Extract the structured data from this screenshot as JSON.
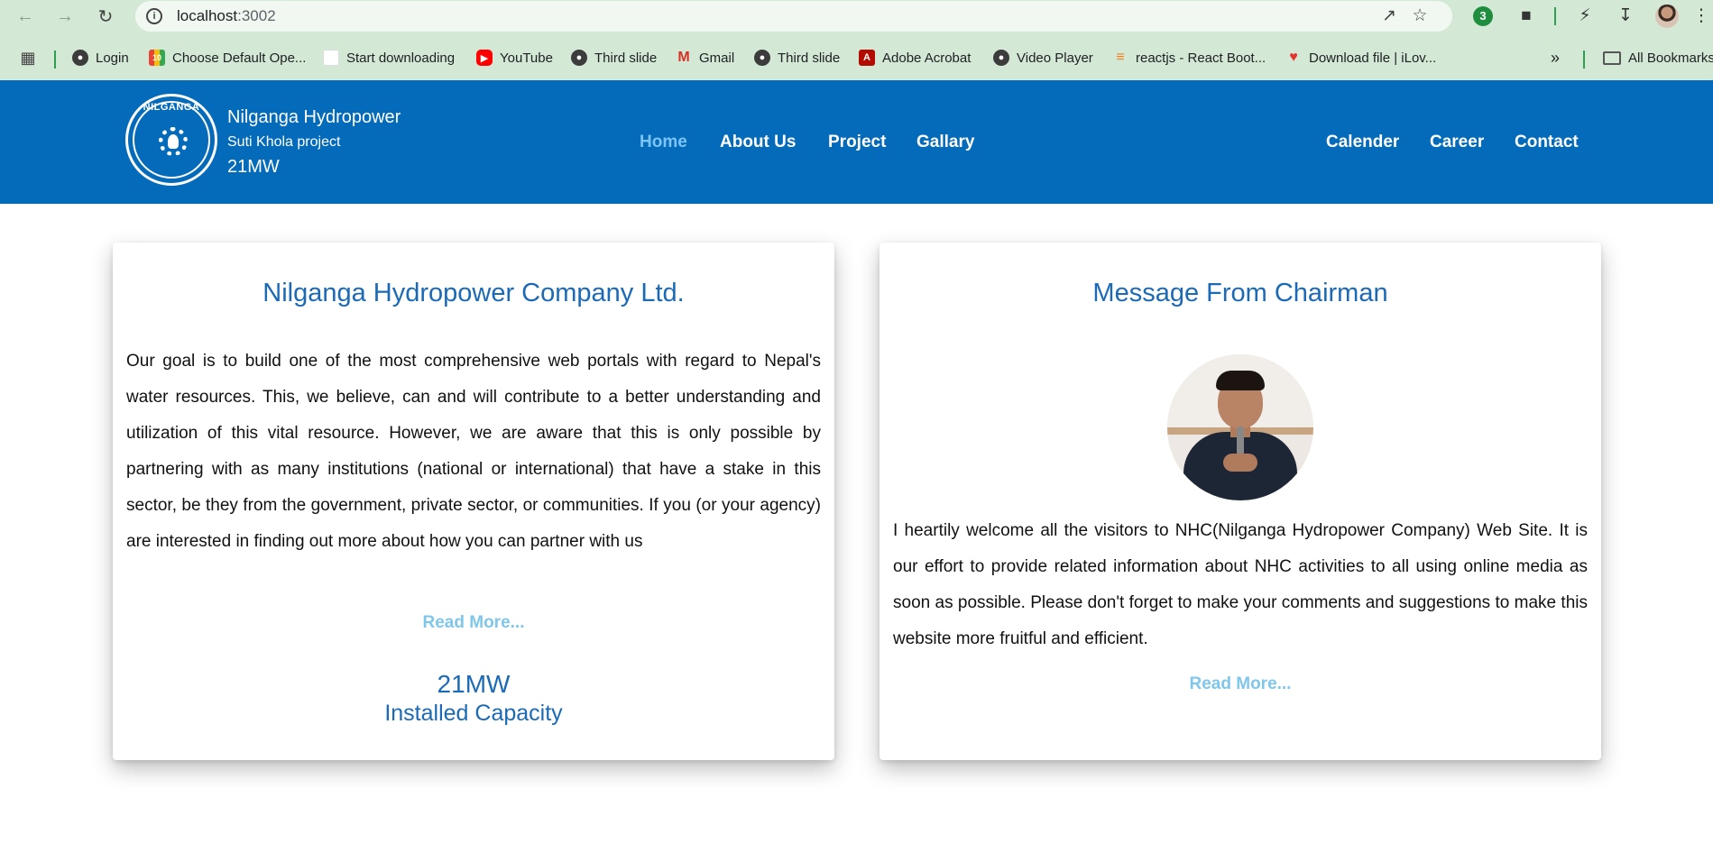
{
  "browser": {
    "url_host": "localhost",
    "url_port": ":3002",
    "extension_badge": "3",
    "bookmarks": [
      {
        "label": "Login",
        "icon": "globe-icon"
      },
      {
        "label": "Choose Default Ope...",
        "icon": "app-icon"
      },
      {
        "label": "Start downloading",
        "icon": "blank-page-icon"
      },
      {
        "label": "YouTube",
        "icon": "youtube-icon"
      },
      {
        "label": "Third slide",
        "icon": "globe-icon"
      },
      {
        "label": "Gmail",
        "icon": "gmail-icon"
      },
      {
        "label": "Third slide",
        "icon": "globe-icon"
      },
      {
        "label": "Adobe Acrobat",
        "icon": "acrobat-icon"
      },
      {
        "label": "Video Player",
        "icon": "globe-icon"
      },
      {
        "label": "reactjs - React Boot...",
        "icon": "stackoverflow-icon"
      },
      {
        "label": "Download file | iLov...",
        "icon": "heart-icon"
      }
    ],
    "overflow_label": "»",
    "all_bookmarks_label": "All Bookmarks"
  },
  "header": {
    "logo_text": "NILGANGA",
    "brand_name": "Nilganga Hydropower",
    "brand_project": "Suti Khola project",
    "brand_capacity": "21MW",
    "nav_left": [
      "Home",
      "About Us",
      "Project",
      "Gallary"
    ],
    "nav_right": [
      "Calender",
      "Career",
      "Contact"
    ],
    "active_color": "#7cc4f5",
    "header_color": "#046aba"
  },
  "about_card": {
    "title": "Nilganga Hydropower Company Ltd.",
    "body": "Our goal is to build one of the most comprehensive web portals with regard to Nepal's water resources. This, we believe, can and will contribute to a better understanding and utilization of this vital resource. However, we are aware that this is only possible by partnering with as many institutions (national or international) that have a stake in this sector, be they from the government, private sector, or communities. If you (or your agency) are interested in finding out more about how you can partner with us",
    "read_more": "Read More...",
    "capacity_value": "21MW",
    "capacity_label": "Installed Capacity"
  },
  "chairman_card": {
    "title": "Message From Chairman",
    "body": "I heartily welcome all the visitors to NHC(Nilganga Hydropower Company) Web Site. It is our effort to provide related information about NHC activities to all using online media as soon as possible. Please don't forget to make your comments and suggestions to make this website more fruitful and efficient.",
    "read_more": "Read More..."
  }
}
